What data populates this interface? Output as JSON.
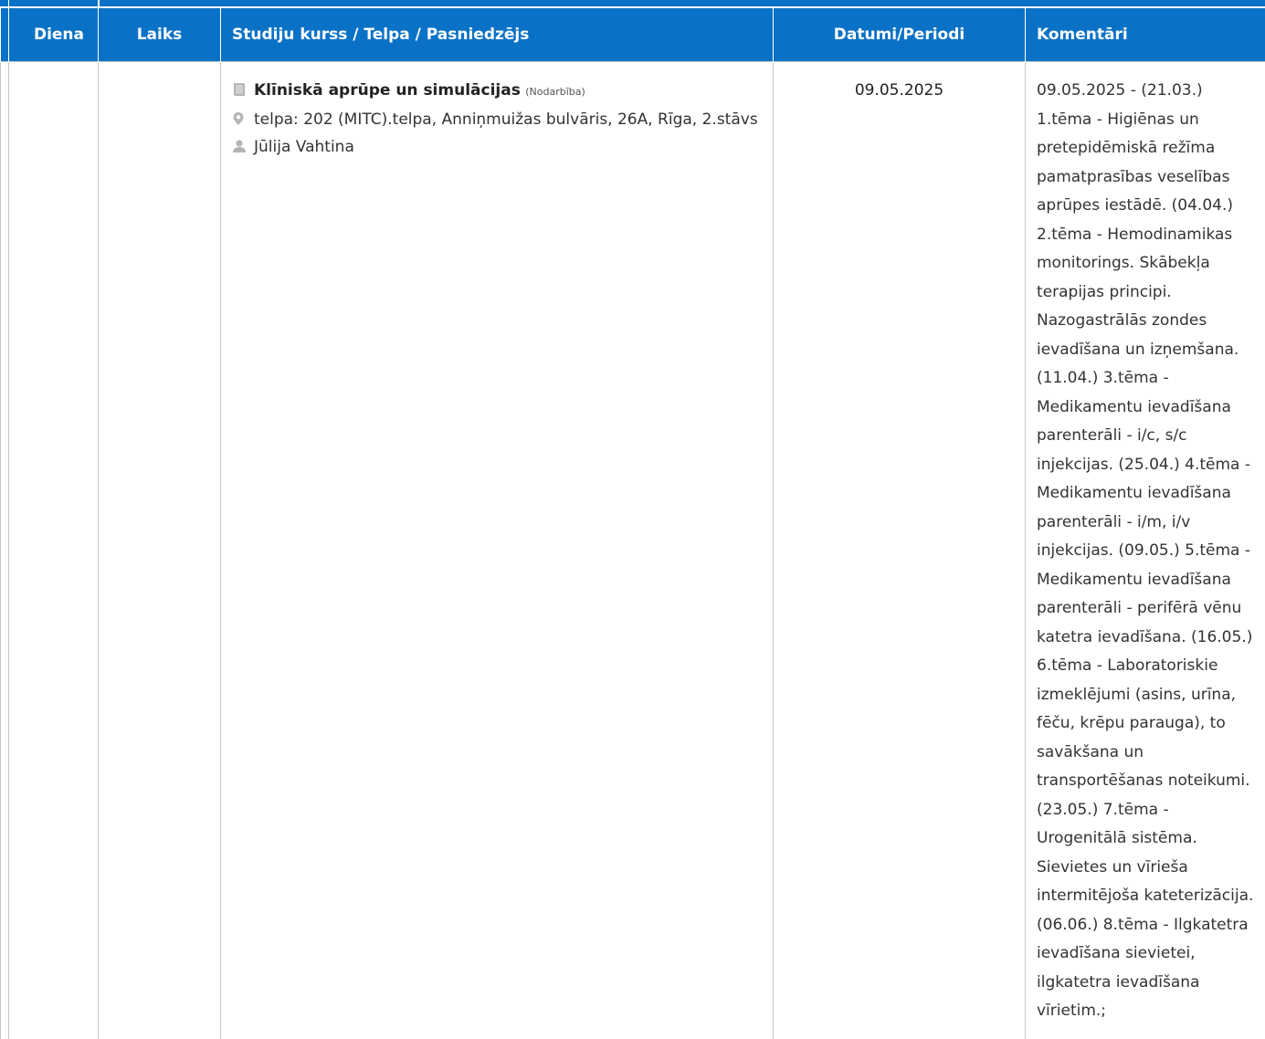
{
  "table": {
    "headers": {
      "day": "Diena",
      "time": "Laiks",
      "course": "Studiju kurss / Telpa / Pasniedzējs",
      "dates": "Datumi/Periodi",
      "comments": "Komentāri"
    },
    "rows": [
      {
        "day": "",
        "time": "",
        "course_title": "Klīniskā aprūpe un simulācijas",
        "course_type": "(Nodarbība)",
        "room": "telpa: 202 (MITC).telpa, Anniņmuižas bulvāris, 26A, Rīga, 2.stāvs",
        "teacher": "Jūlija Vahtina",
        "dates": "09.05.2025",
        "comment": "09.05.2025 - (21.03.) 1.tēma - Higiēnas un pretepidēmiskā režīma pamatprasības veselības aprūpes iestādē. (04.04.) 2.tēma - Hemodinamikas monitorings. Skābekļa terapijas principi. Nazogastrālās zondes ievadīšana un izņemšana. (11.04.) 3.tēma - Medikamentu ievadīšana parenterāli - i/c, s/c injekcijas. (25.04.) 4.tēma - Medikamentu ievadīšana parenterāli - i/m, i/v injekcijas. (09.05.) 5.tēma - Medikamentu ievadīšana parenterāli - perifērā vēnu katetra ievadīšana. (16.05.) 6.tēma - Laboratoriskie izmeklējumi (asins, urīna, fēču, krēpu parauga), to savākšana un transportēšanas noteikumi. (23.05.) 7.tēma - Urogenitālā sistēma. Sievietes un vīrieša intermitējoša kateterizācija. (06.06.) 8.tēma - Ilgkatetra ievadīšana sievietei, ilgkatetra ievadīšana vīrietim.;"
      }
    ]
  },
  "icons": {
    "course": "book-icon",
    "room": "map-marker-icon",
    "teacher": "user-icon"
  },
  "colors": {
    "header_bg": "#0a72c6",
    "header_text": "#ffffff",
    "icon": "#b5b5b5",
    "border": "#c8c8c8"
  }
}
